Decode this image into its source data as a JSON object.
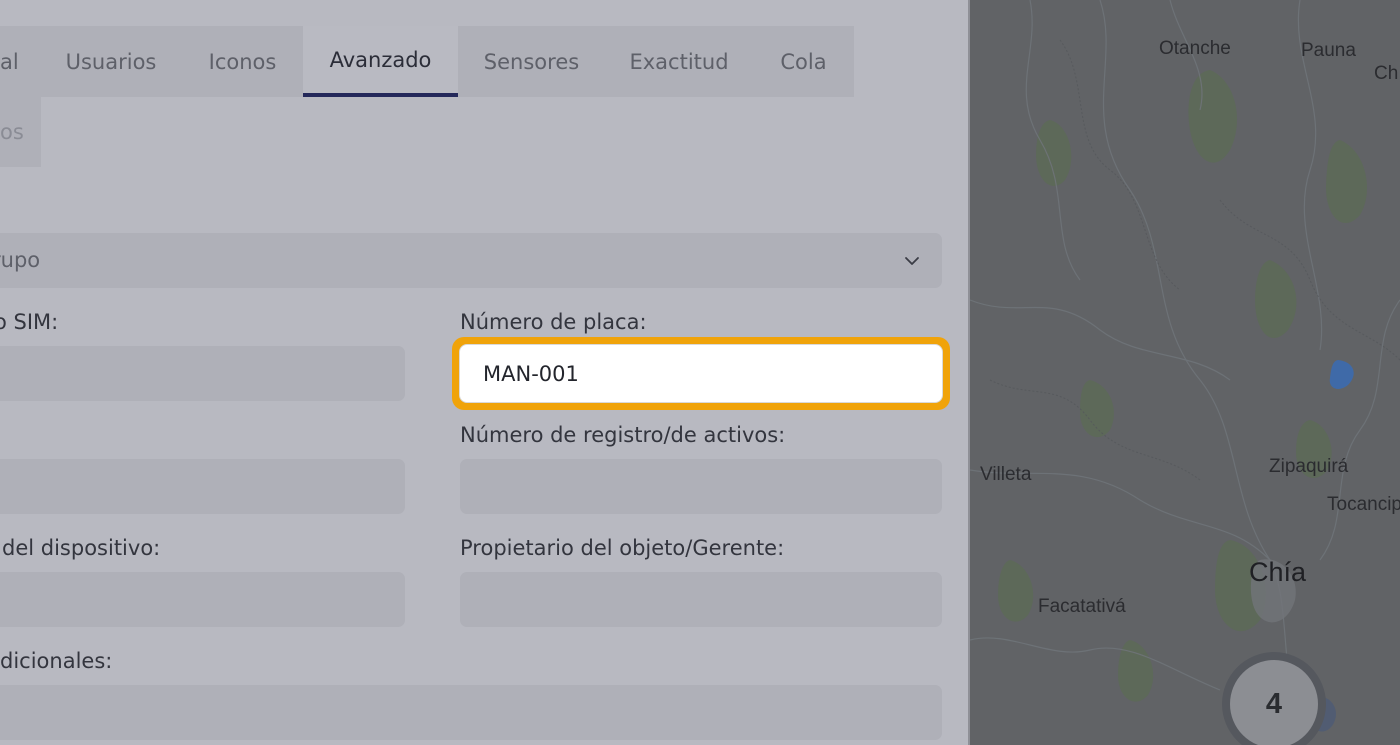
{
  "tabs": [
    {
      "label": "al",
      "active": false
    },
    {
      "label": "Usuarios",
      "active": false
    },
    {
      "label": "Iconos",
      "active": false
    },
    {
      "label": "Avanzado",
      "active": true
    },
    {
      "label": "Sensores",
      "active": false
    },
    {
      "label": "Exactitud",
      "active": false
    },
    {
      "label": "Cola",
      "active": false
    },
    {
      "label": "os",
      "active": false
    }
  ],
  "form": {
    "group_select": {
      "value": "rupo"
    },
    "sim_label": "o SIM:",
    "plate_label": "Número de placa:",
    "plate_value": "MAN-001",
    "registry_label": "Número de registro/de activos:",
    "device_label": "del dispositivo:",
    "owner_label": "Propietario del objeto/Gerente:",
    "additional_label": "dicionales:"
  },
  "map": {
    "towns": [
      "Otanche",
      "Pauna",
      "Ch",
      "Villeta",
      "Zipaquirá",
      "Tocancip",
      "Chía",
      "Facatativá"
    ],
    "cluster_count": "4"
  },
  "colors": {
    "focus_ring": "#f0a30a",
    "active_tab_underline": "#24285a"
  }
}
